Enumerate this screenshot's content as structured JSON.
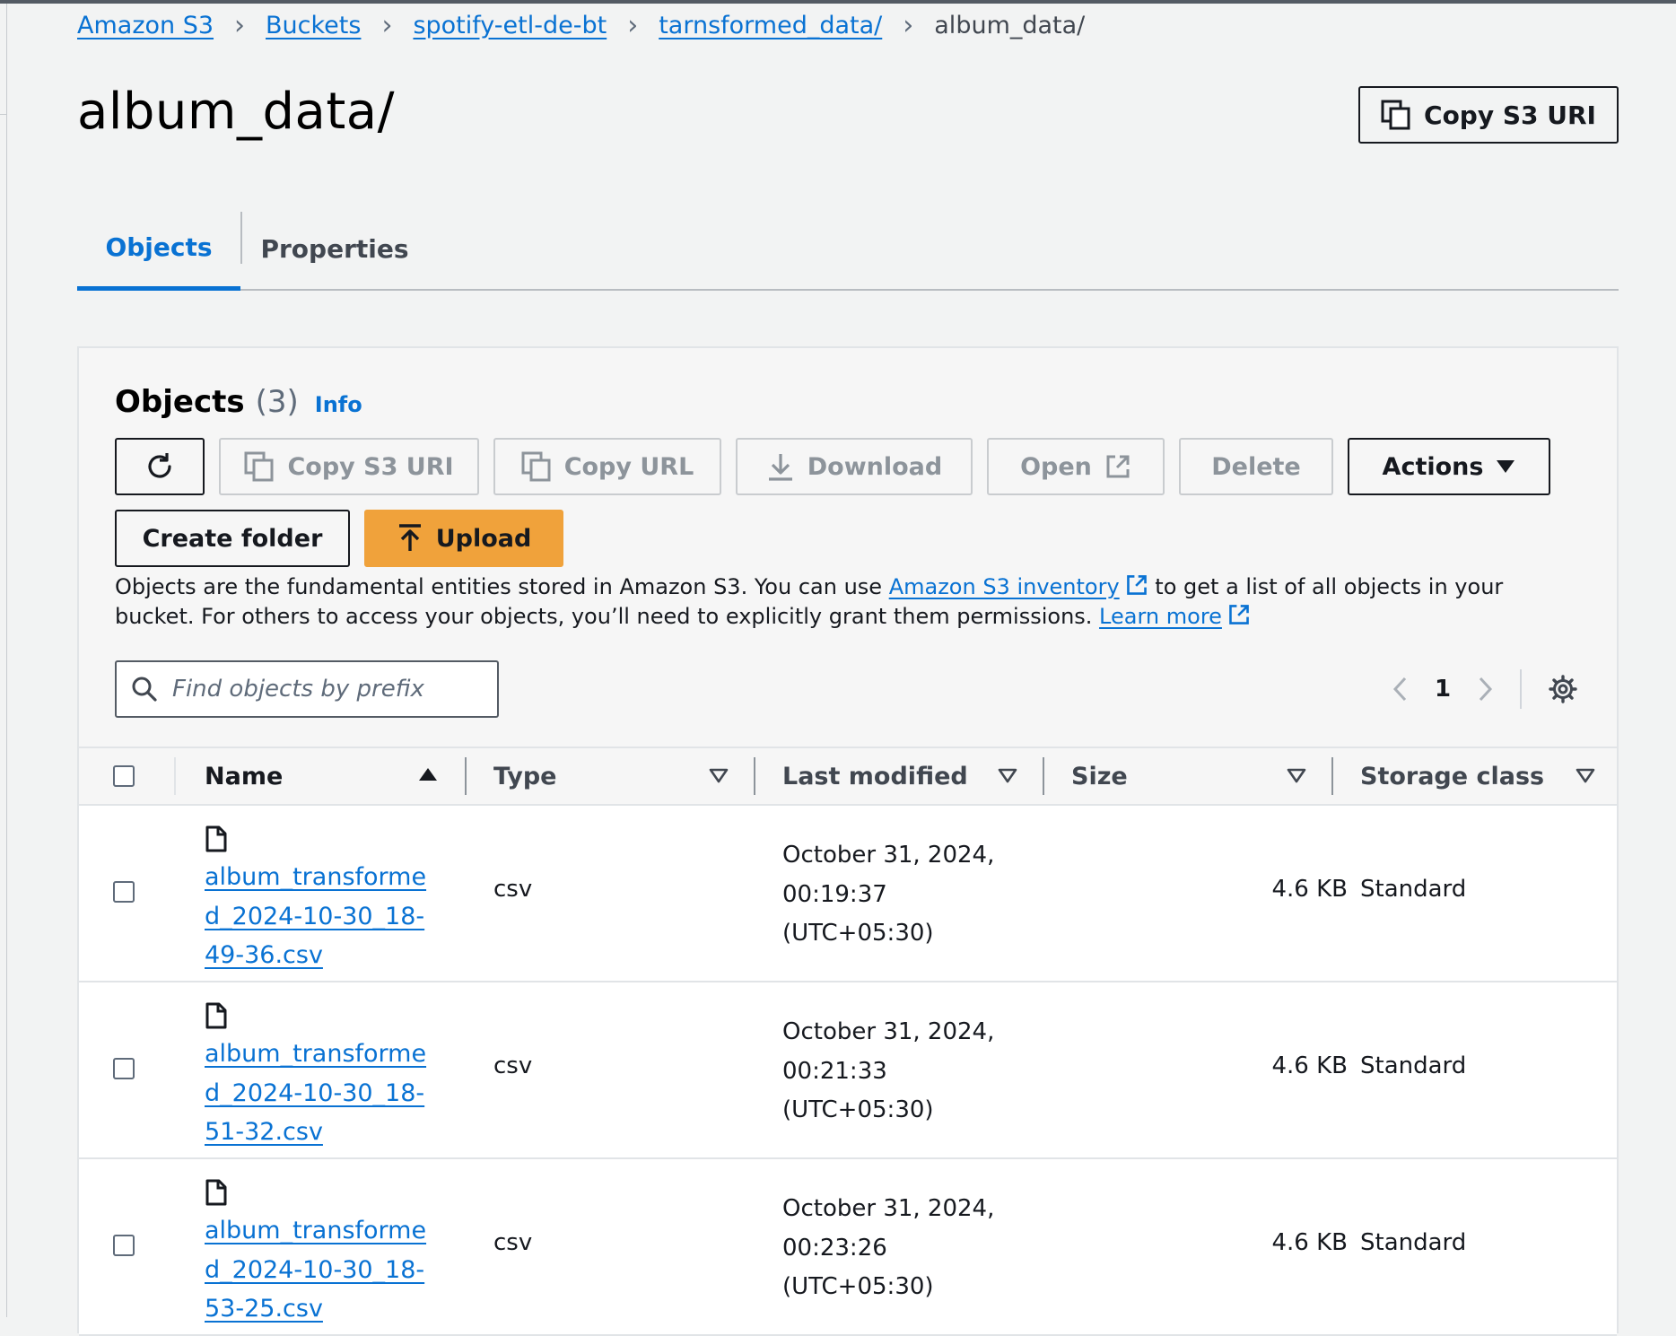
{
  "breadcrumb": {
    "items": [
      {
        "label": "Amazon S3"
      },
      {
        "label": "Buckets"
      },
      {
        "label": "spotify-etl-de-bt"
      },
      {
        "label": "tarnsformed_data/"
      }
    ],
    "current": "album_data/"
  },
  "page": {
    "title": "album_data/",
    "copy_uri_label": "Copy S3 URI"
  },
  "tabs": [
    {
      "label": "Objects",
      "active": true
    },
    {
      "label": "Properties",
      "active": false
    }
  ],
  "objects_panel": {
    "title": "Objects",
    "count": "(3)",
    "info": "Info",
    "toolbar": {
      "refresh_icon": "refresh-icon",
      "copy_uri": "Copy S3 URI",
      "copy_url": "Copy URL",
      "download": "Download",
      "open": "Open",
      "delete": "Delete",
      "actions": "Actions",
      "create_folder": "Create folder",
      "upload": "Upload"
    },
    "description": {
      "text1": "Objects are the fundamental entities stored in Amazon S3. You can use ",
      "link1": "Amazon S3 inventory",
      "text2": " to get a list of all objects in your bucket. For others to access your objects, you’ll need to explicitly grant them permissions. ",
      "link2": "Learn more"
    },
    "search": {
      "placeholder": "Find objects by prefix",
      "value": ""
    },
    "pagination": {
      "current_page": "1"
    }
  },
  "table": {
    "columns": [
      "Name",
      "Type",
      "Last modified",
      "Size",
      "Storage class"
    ],
    "rows": [
      {
        "name": "album_transformed_2024-10-30_18-49-36.csv",
        "type": "csv",
        "last_modified": "October 31, 2024, 00:19:37 (UTC+05:30)",
        "size": "4.6 KB",
        "storage_class": "Standard"
      },
      {
        "name": "album_transformed_2024-10-30_18-51-32.csv",
        "type": "csv",
        "last_modified": "October 31, 2024, 00:21:33 (UTC+05:30)",
        "size": "4.6 KB",
        "storage_class": "Standard"
      },
      {
        "name": "album_transformed_2024-10-30_18-53-25.csv",
        "type": "csv",
        "last_modified": "October 31, 2024, 00:23:26 (UTC+05:30)",
        "size": "4.6 KB",
        "storage_class": "Standard"
      }
    ]
  },
  "colors": {
    "link": "#0972d3",
    "primary_button": "#f0a23b",
    "text": "#16191f",
    "disabled": "#8d949b"
  }
}
